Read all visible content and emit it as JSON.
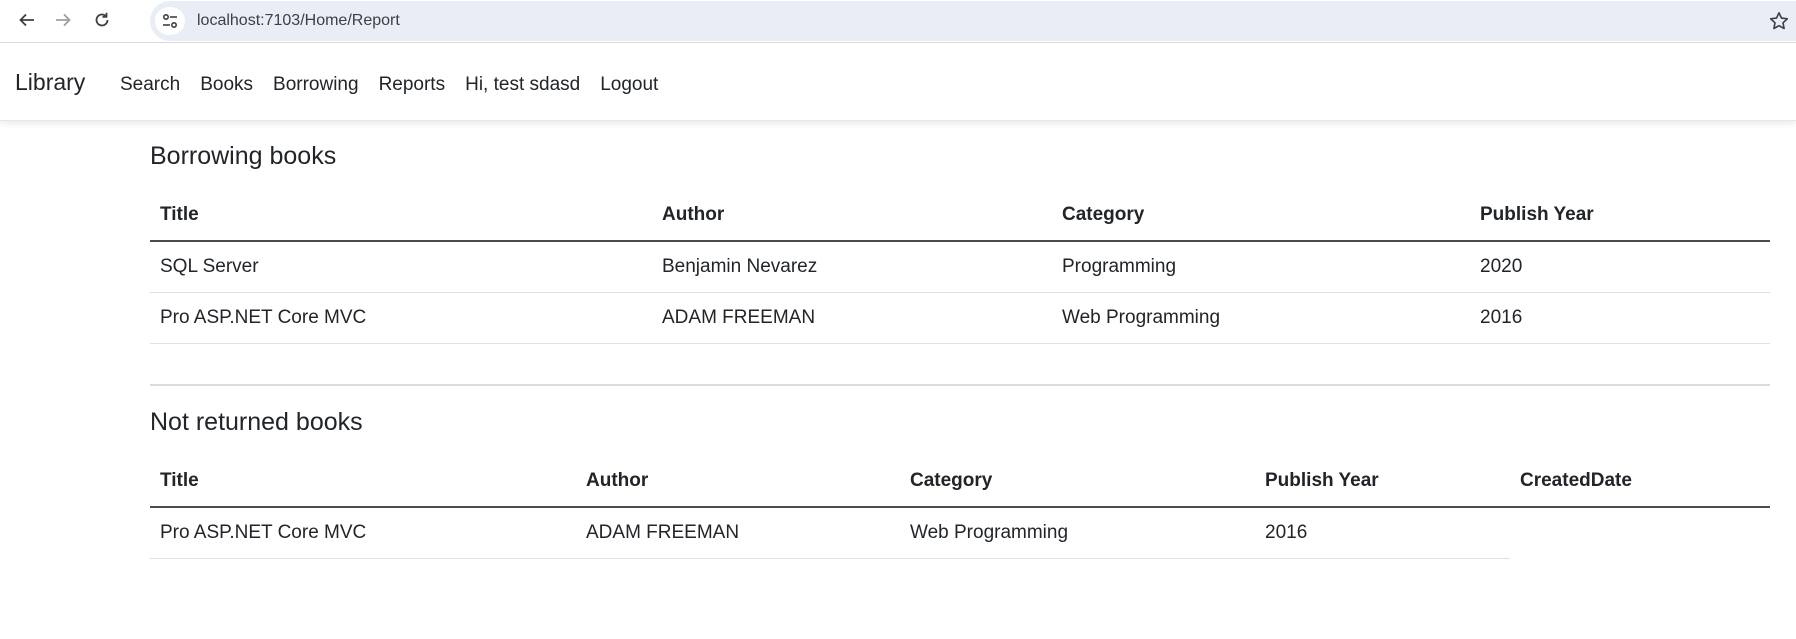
{
  "browser": {
    "url": "localhost:7103/Home/Report"
  },
  "navbar": {
    "brand": "Library",
    "links": [
      "Search",
      "Books",
      "Borrowing",
      "Reports",
      "Hi, test sdasd",
      "Logout"
    ]
  },
  "borrowing": {
    "title": "Borrowing books",
    "headers": [
      "Title",
      "Author",
      "Category",
      "Publish Year"
    ],
    "rows": [
      [
        "SQL Server",
        "Benjamin Nevarez",
        "Programming",
        "2020"
      ],
      [
        "Pro ASP.NET Core MVC",
        "ADAM FREEMAN",
        "Web Programming",
        "2016"
      ]
    ]
  },
  "not_returned": {
    "title": "Not returned books",
    "headers": [
      "Title",
      "Author",
      "Category",
      "Publish Year",
      "CreatedDate"
    ],
    "rows": [
      [
        "Pro ASP.NET Core MVC",
        "ADAM FREEMAN",
        "Web Programming",
        "2016",
        ""
      ]
    ]
  }
}
